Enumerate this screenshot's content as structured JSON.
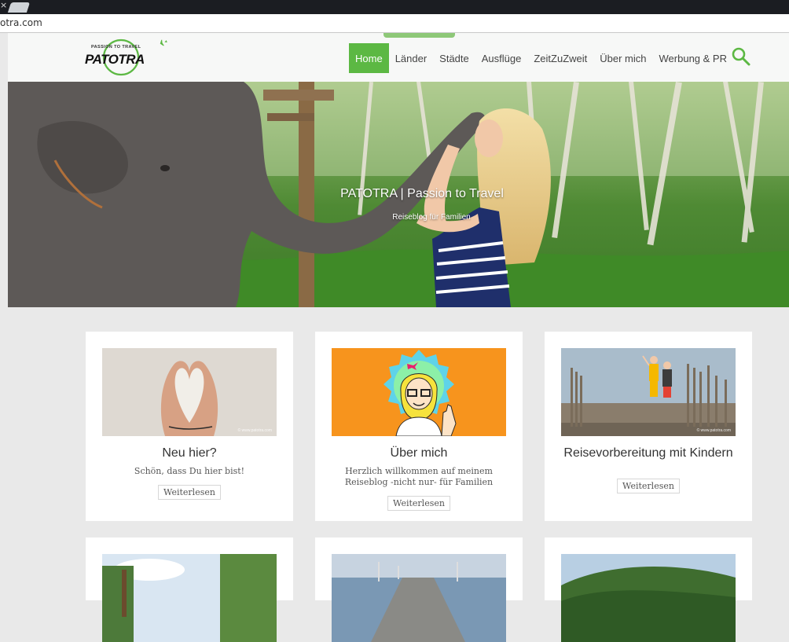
{
  "browser": {
    "tab_close_glyph": "×",
    "url": "otra.com"
  },
  "header": {
    "logo": {
      "tagline": "PASSION TO TRAVEL",
      "wordmark": "PATOTRA",
      "icon": "airplane-icon"
    },
    "nav": [
      {
        "label": "Home",
        "active": true
      },
      {
        "label": "Länder",
        "active": false
      },
      {
        "label": "Städte",
        "active": false
      },
      {
        "label": "Ausflüge",
        "active": false
      },
      {
        "label": "ZeitZuZweit",
        "active": false
      },
      {
        "label": "Über mich",
        "active": false
      },
      {
        "label": "Werbung & PR",
        "active": false
      }
    ],
    "search_icon": "search-icon",
    "accent_color": "#5cb843"
  },
  "hero": {
    "title": "PATOTRA | Passion to Travel",
    "subtitle": "Reiseblog für Familien"
  },
  "cards": [
    {
      "title": "Neu hier?",
      "text": "Schön, dass Du hier bist!",
      "button": "Weiterlesen",
      "watermark": "© www.patotra.com"
    },
    {
      "title": "Über mich",
      "text": "Herzlich willkommen auf meinem Reiseblog -nicht nur- für Familien",
      "button": "Weiterlesen"
    },
    {
      "title": "Reisevorbereitung mit Kindern",
      "text": "",
      "button": "Weiterlesen",
      "watermark": "© www.patotra.com"
    }
  ]
}
